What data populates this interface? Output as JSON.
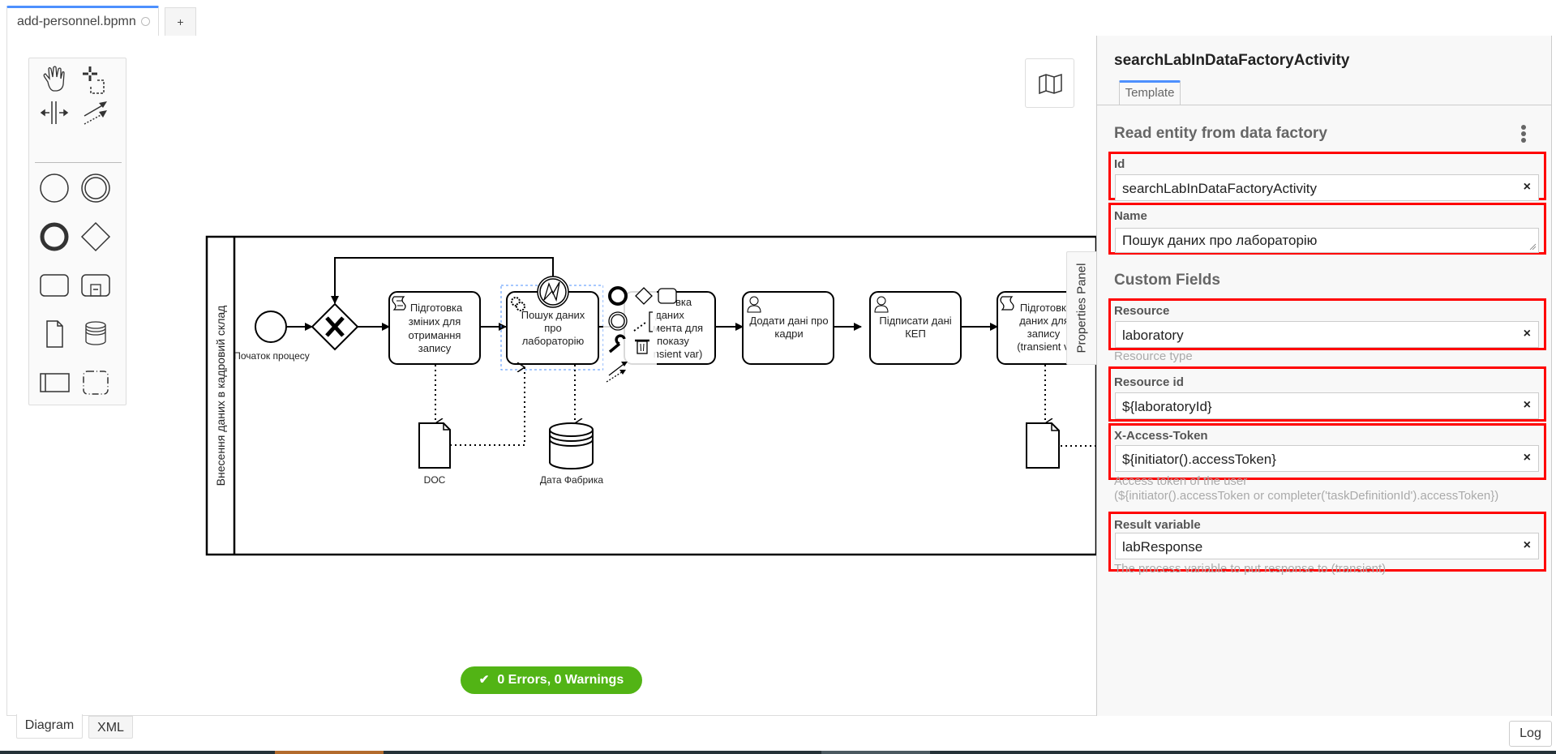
{
  "tabs": {
    "file_tab_label": "add-personnel.bpmn",
    "add_tab_label": "+"
  },
  "palette": {
    "tools": [
      "hand-tool",
      "lasso-tool",
      "space-tool",
      "global-connect-tool",
      "create-start-event",
      "create-intermediate-event",
      "create-end-event",
      "create-gateway",
      "create-task",
      "create-subprocess",
      "create-data-object",
      "create-data-store",
      "create-pool",
      "create-group"
    ]
  },
  "diagram": {
    "lane_label": "Внесення даних в кадровий склад",
    "start_event_label": "Початок процесу",
    "tasks": [
      {
        "type": "script",
        "label": [
          "Підготовка",
          "зміних для",
          "отримання",
          "запису"
        ]
      },
      {
        "type": "service",
        "label": [
          "Пошук даних",
          "про",
          "лабораторію"
        ],
        "selected": true
      },
      {
        "type": "script",
        "label": [
          "вка",
          "даних",
          "мента для",
          "показу",
          "nsient var)"
        ]
      },
      {
        "type": "user",
        "label": [
          "Додати дані про",
          "кадри"
        ]
      },
      {
        "type": "user",
        "label": [
          "Підписати дані",
          "КЕП"
        ]
      },
      {
        "type": "script",
        "label": [
          "Підготовка",
          "даних для",
          "запису",
          "(transient va"
        ]
      }
    ],
    "data_object_label": "DOC",
    "data_store_label": "Дата Фабрика"
  },
  "status": {
    "badge_text": "0 Errors, 0 Warnings",
    "badge_color": "#52b415"
  },
  "properties_toggle_label": "Properties Panel",
  "panel": {
    "title": "searchLabInDataFactoryActivity",
    "tab_label": "Template",
    "group1_title": "Read entity from data factory",
    "group2_title": "Custom Fields",
    "fields": {
      "id": {
        "label": "Id",
        "value": "searchLabInDataFactoryActivity"
      },
      "name": {
        "label": "Name",
        "value": "Пошук даних про лабораторію"
      },
      "resource": {
        "label": "Resource",
        "value": "laboratory",
        "description": "Resource type"
      },
      "resource_id": {
        "label": "Resource id",
        "value": "${laboratoryId}"
      },
      "access_token": {
        "label": "X-Access-Token",
        "value": "${initiator().accessToken}",
        "description_line1": "Access token of the user",
        "description_line2": "(${initiator().accessToken or completer('taskDefinitionId').accessToken})"
      },
      "result_variable": {
        "label": "Result variable",
        "value": "labResponse",
        "description": "The process variable to put response to (transient)"
      }
    },
    "clear_glyph": "×",
    "highlight_color": "#ff0000"
  },
  "bottom": {
    "diagram_tab": "Diagram",
    "xml_tab": "XML",
    "log_button": "Log"
  }
}
